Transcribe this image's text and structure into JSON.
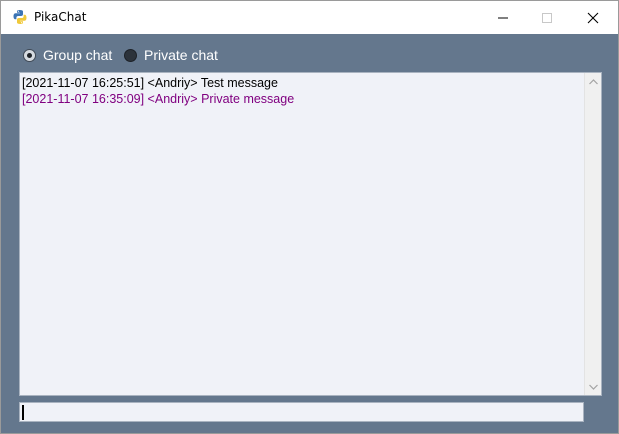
{
  "window": {
    "title": "PikaChat",
    "icon": "python-icon"
  },
  "mode": {
    "group_label": "Group chat",
    "private_label": "Private chat",
    "selected": "group"
  },
  "chat": {
    "messages": [
      {
        "text": "[2021-11-07 16:25:51] <Andriy> Test message",
        "type": "group"
      },
      {
        "text": "[2021-11-07 16:35:09] <Andriy> Private message",
        "type": "private"
      }
    ]
  },
  "input": {
    "value": ""
  },
  "colors": {
    "window_bg": "#64778d",
    "private_message": "#800080",
    "group_message": "#000000"
  }
}
